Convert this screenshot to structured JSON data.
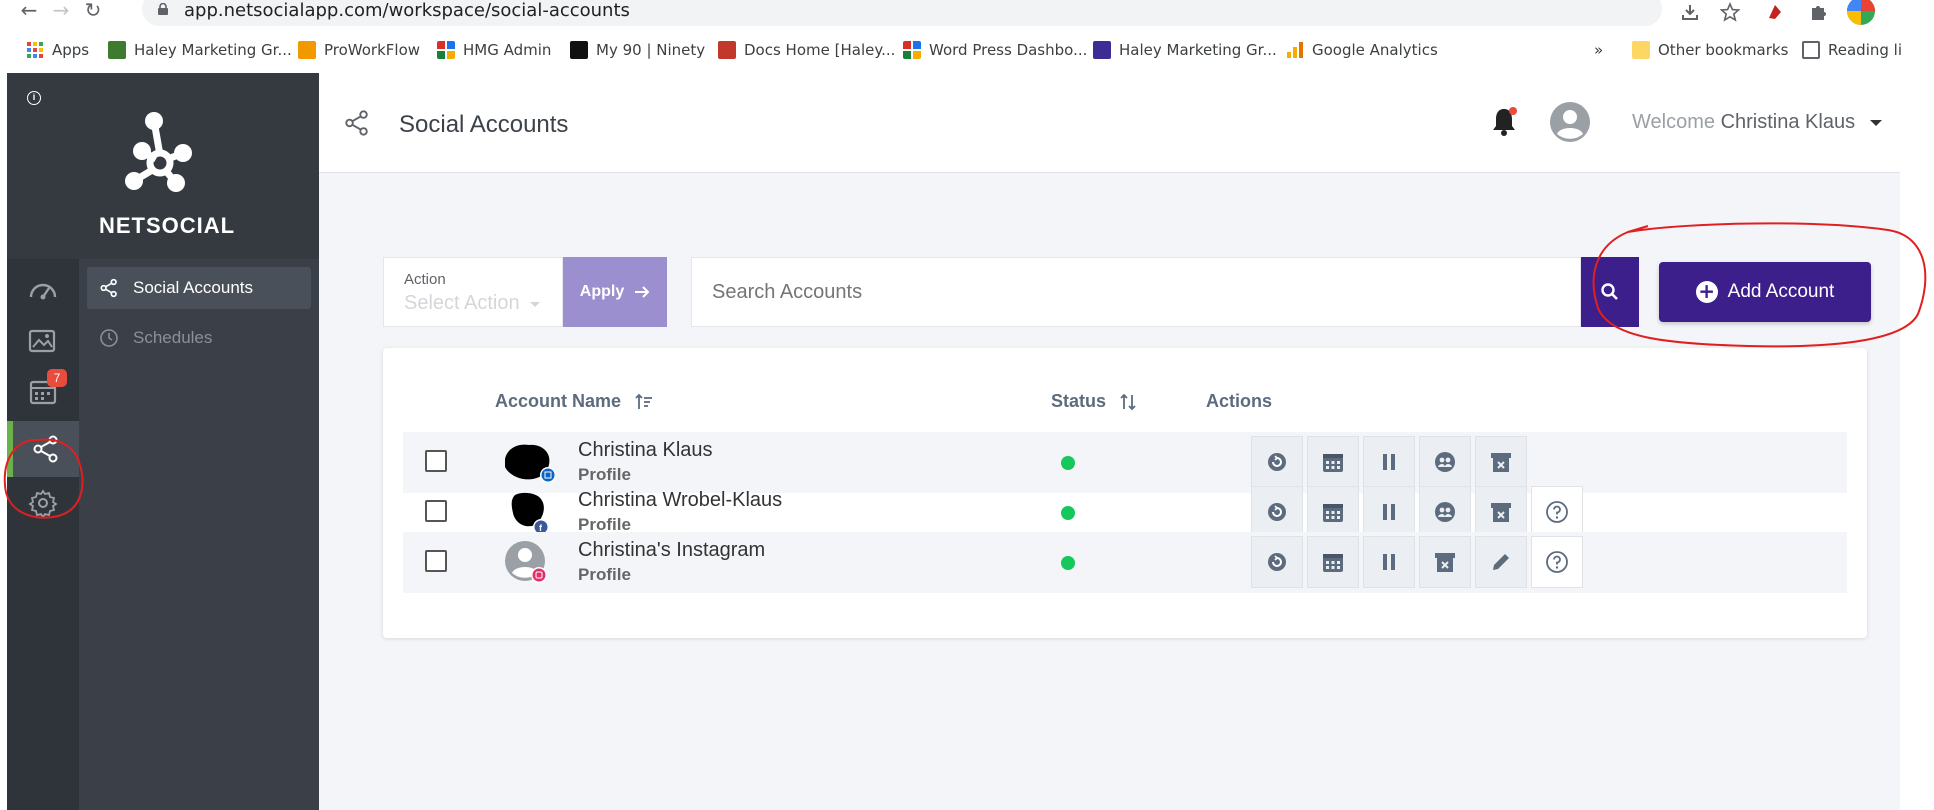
{
  "browser": {
    "url": "app.netsocialapp.com/workspace/social-accounts",
    "bookmarks": [
      {
        "label": "Apps",
        "color": "#ea4335"
      },
      {
        "label": "Haley Marketing Gr...",
        "color": "#3e7a2f"
      },
      {
        "label": "ProWorkFlow",
        "color": "#f29900"
      },
      {
        "label": "HMG Admin",
        "color": "#d93025"
      },
      {
        "label": "My 90 | Ninety",
        "color": "#111111"
      },
      {
        "label": "Docs Home [Haley...",
        "color": "#c0392b"
      },
      {
        "label": "Word Press Dashbo...",
        "color": "#d93025"
      },
      {
        "label": "Haley Marketing Gr...",
        "color": "#3f2b96"
      },
      {
        "label": "Google Analytics",
        "color": "#f9ab00"
      }
    ],
    "overflow": "»",
    "other_bookmarks": "Other bookmarks",
    "reading_list": "Reading li"
  },
  "brand": {
    "name": "NETSOCIAL"
  },
  "rail": {
    "items": [
      {
        "icon": "dashboard-icon"
      },
      {
        "icon": "media-icon"
      },
      {
        "icon": "calendar-icon",
        "badge": "7"
      },
      {
        "icon": "share-icon",
        "active": true
      },
      {
        "icon": "gear-icon"
      }
    ]
  },
  "subnav": {
    "items": [
      {
        "label": "Social Accounts",
        "active": true
      },
      {
        "label": "Schedules",
        "active": false
      }
    ]
  },
  "header": {
    "title": "Social Accounts",
    "welcome_prefix": "Welcome",
    "user_name": "Christina Klaus"
  },
  "toolbar": {
    "action_label": "Action",
    "action_placeholder": "Select Action",
    "apply_label": "Apply",
    "search_placeholder": "Search Accounts",
    "add_label": "Add Account"
  },
  "table": {
    "columns": {
      "name": "Account Name",
      "status": "Status",
      "actions": "Actions"
    },
    "rows": [
      {
        "name": "Christina Klaus",
        "type": "Profile",
        "network": "linkedin",
        "network_color": "#0a66c2",
        "status": "active",
        "actions": [
          "refresh-icon",
          "calendar-icon",
          "pause-icon",
          "groups-icon",
          "archive-icon"
        ]
      },
      {
        "name": "Christina Wrobel-Klaus",
        "type": "Profile",
        "network": "facebook",
        "network_color": "#3b5998",
        "status": "active",
        "actions": [
          "refresh-icon",
          "calendar-icon",
          "pause-icon",
          "groups-icon",
          "archive-icon",
          "help-icon"
        ]
      },
      {
        "name": "Christina's Instagram",
        "type": "Profile",
        "network": "instagram",
        "network_color": "#e1306c",
        "status": "active",
        "actions": [
          "refresh-icon",
          "calendar-icon",
          "pause-icon",
          "archive-icon",
          "edit-icon",
          "help-icon"
        ]
      }
    ]
  },
  "colors": {
    "primary": "#3d1f8b",
    "apply": "#9c8fd0",
    "active_green": "#16c75c",
    "annotation": "#e02020"
  }
}
